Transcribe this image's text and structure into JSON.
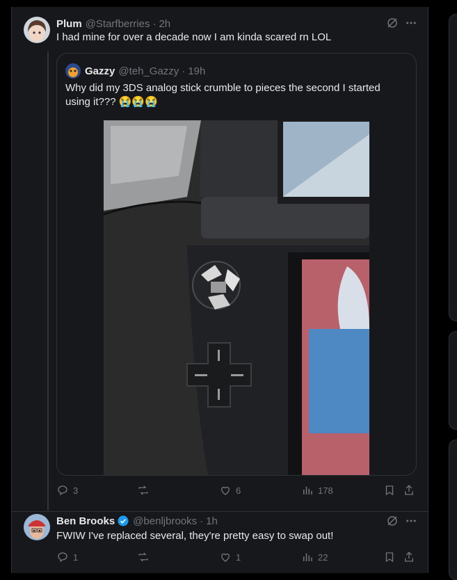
{
  "post1": {
    "name": "Plum",
    "handle": "@Starfberries",
    "time": "2h",
    "text": "I had mine for over a decade now I am kinda scared rn LOL",
    "quote": {
      "name": "Gazzy",
      "handle": "@teh_Gazzy",
      "time": "19h",
      "text": "Why did my 3DS analog stick crumble to pieces the second I started using it??? 😭😭😭"
    },
    "actions": {
      "replies": "3",
      "reposts": "",
      "likes": "6",
      "views": "178"
    }
  },
  "post2": {
    "name": "Ben Brooks",
    "handle": "@benljbrooks",
    "time": "1h",
    "text": "FWIW I've replaced several, they're pretty easy to swap out!",
    "actions": {
      "replies": "1",
      "reposts": "",
      "likes": "1",
      "views": "22"
    }
  },
  "separator": "·",
  "icons": [
    "grok-icon",
    "more-icon",
    "reply-icon",
    "repost-icon",
    "like-icon",
    "views-icon",
    "bookmark-icon",
    "share-icon",
    "verified-badge-icon"
  ]
}
